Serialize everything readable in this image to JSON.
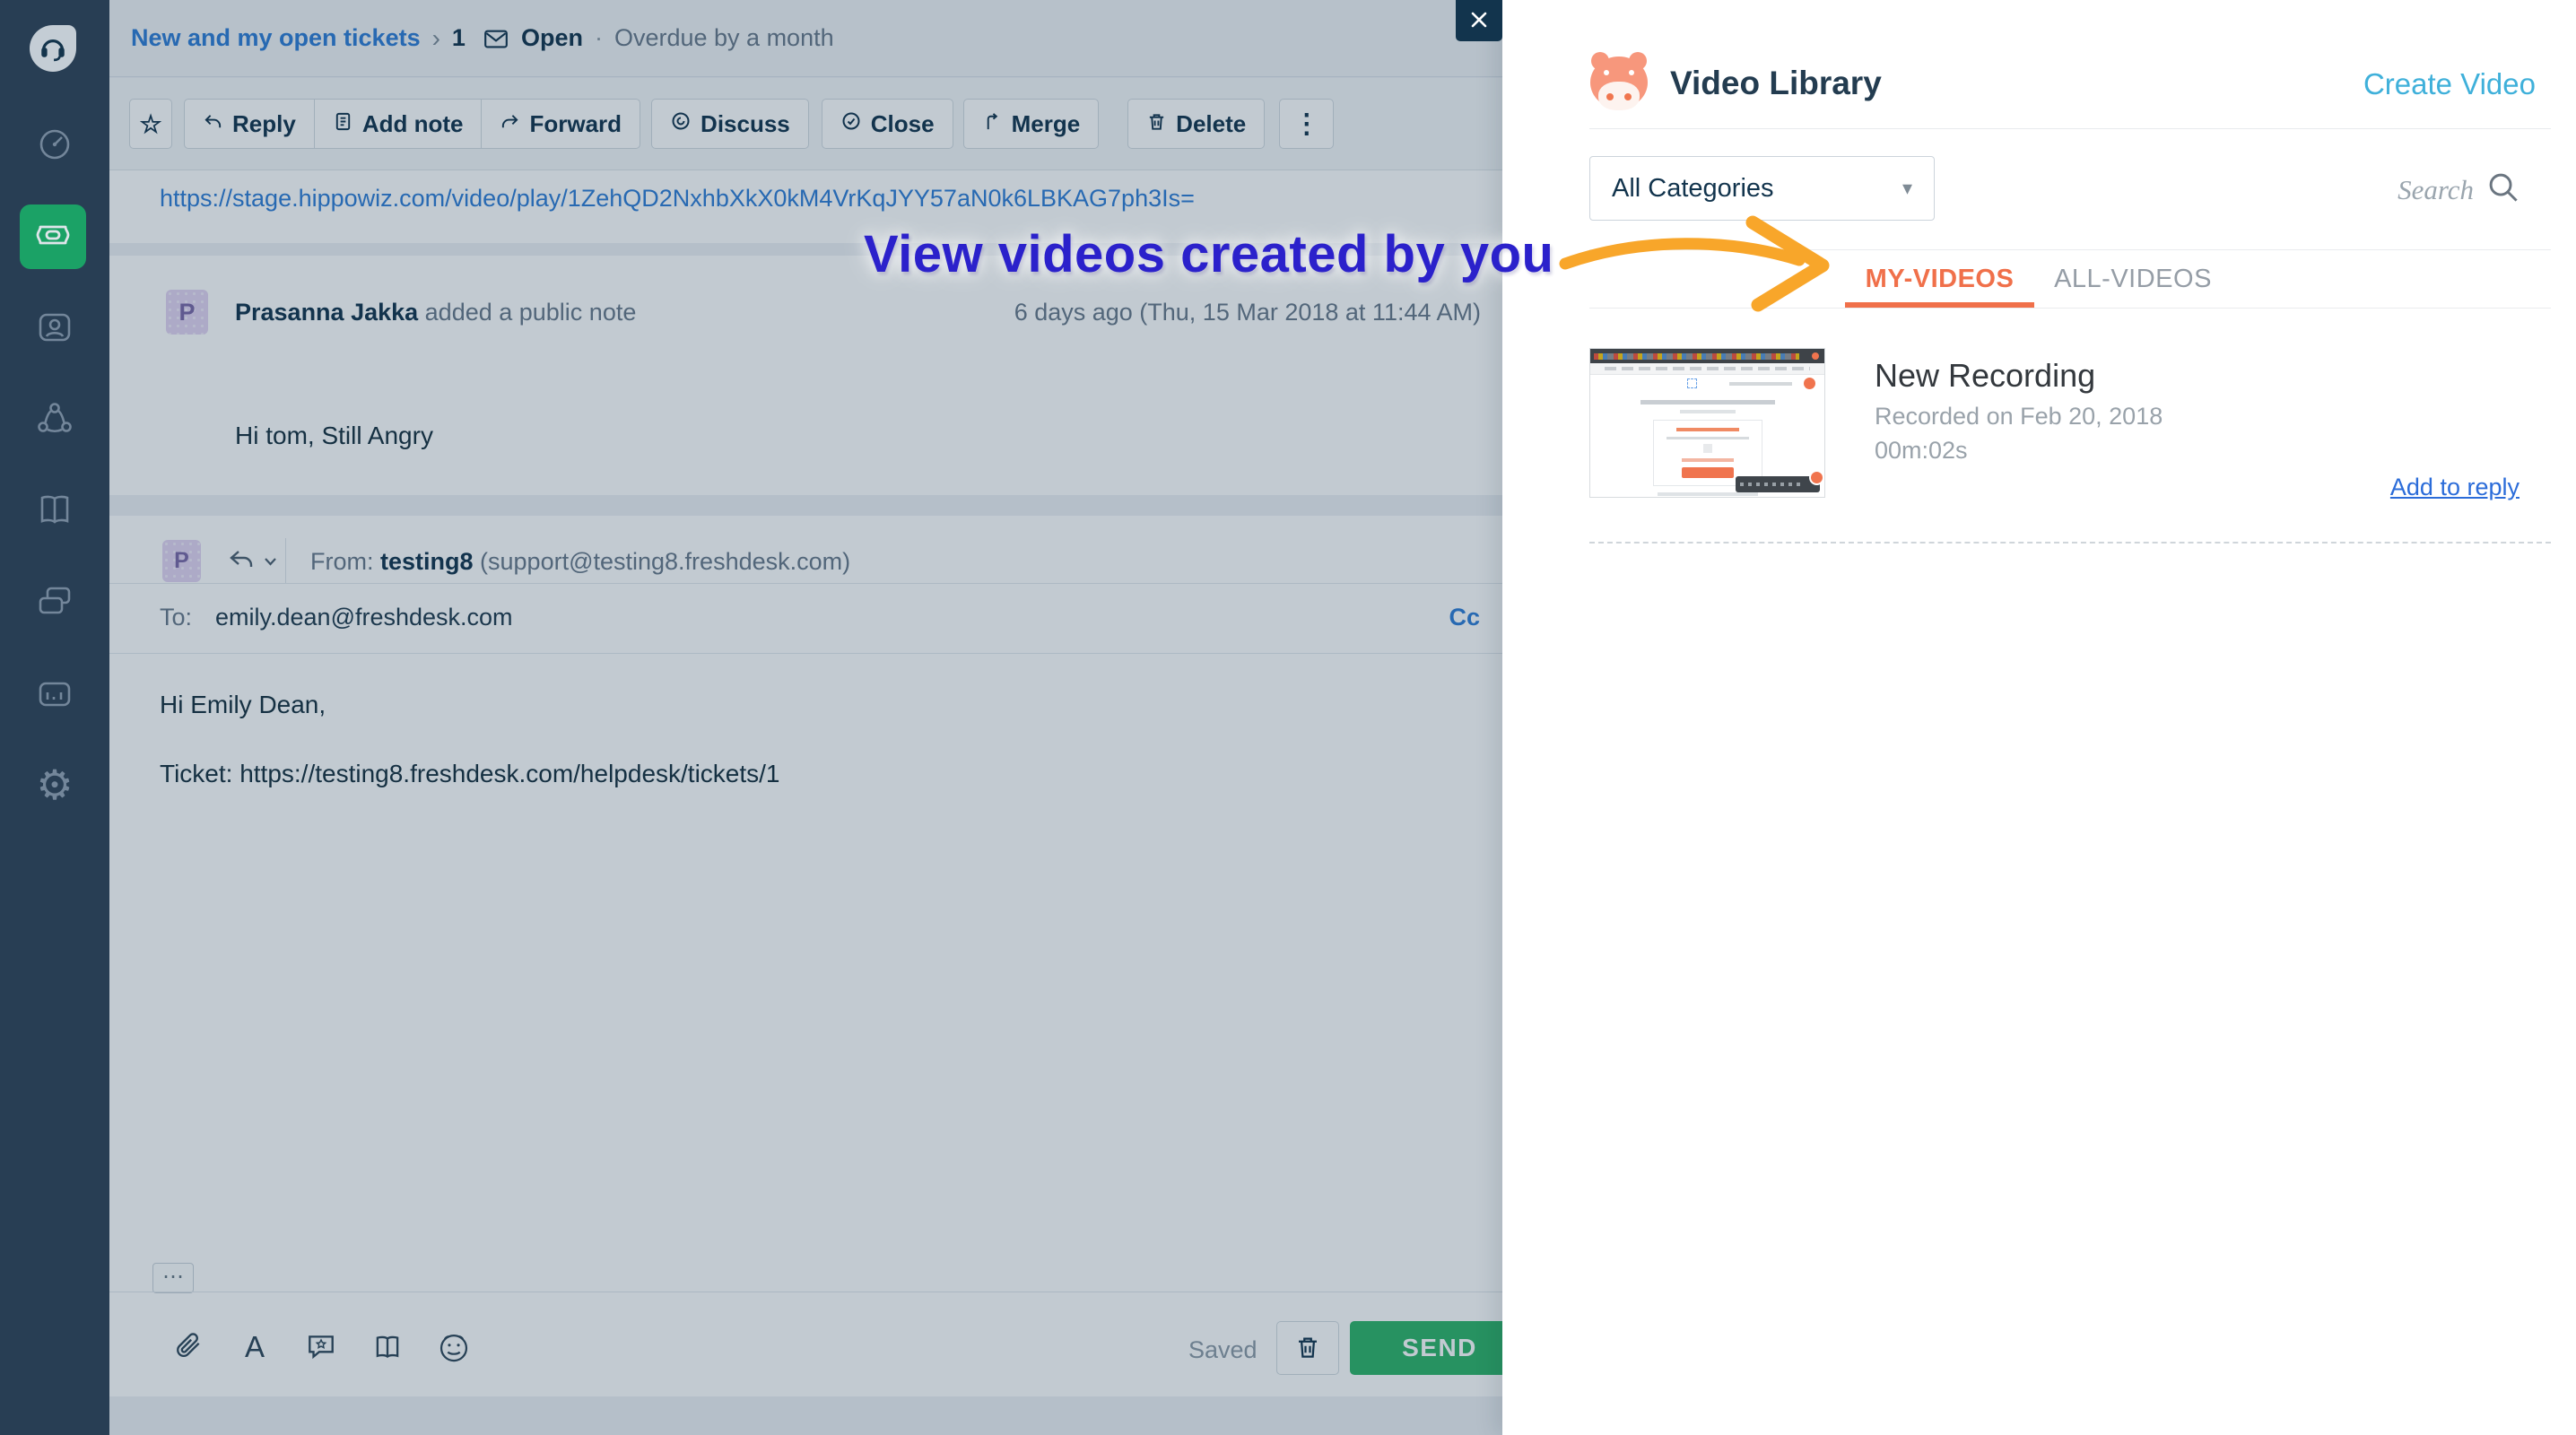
{
  "glyphs": {
    "star": "☆",
    "more": "⋮",
    "ellipsis": "⋯",
    "caret": "▾",
    "breadcrumb_sep": "›",
    "status_sep": "·",
    "gear": "⚙",
    "format_a": "A"
  },
  "sidebar": {
    "items": [
      {
        "name": "dashboard"
      },
      {
        "name": "tickets",
        "active": true
      },
      {
        "name": "contacts"
      },
      {
        "name": "social"
      },
      {
        "name": "solutions"
      },
      {
        "name": "forums"
      },
      {
        "name": "reports"
      },
      {
        "name": "settings"
      }
    ]
  },
  "header": {
    "breadcrumb": "New and my open tickets",
    "ticket_number": "1",
    "status": "Open",
    "overdue": "Overdue by a month"
  },
  "toolbar": {
    "reply": "Reply",
    "add_note": "Add note",
    "forward": "Forward",
    "discuss": "Discuss",
    "close": "Close",
    "merge": "Merge",
    "delete": "Delete"
  },
  "conversation": {
    "link": "https://stage.hippowiz.com/video/play/1ZehQD2NxhbXkX0kM4VrKqJYY57aN0k6LBKAG7ph3Is=",
    "note": {
      "avatar_initial": "P",
      "author": "Prasanna Jakka",
      "action": " added a public note",
      "timestamp": "6 days ago (Thu, 15 Mar 2018 at 11:44 AM)",
      "body": "Hi tom, Still Angry"
    },
    "reply": {
      "avatar_initial": "P",
      "from_label": "From: ",
      "from_name": "testing8",
      "from_email": " (support@testing8.freshdesk.com)",
      "to_label": "To:",
      "to_value": "emily.dean@freshdesk.com",
      "cc_label": "Cc",
      "body_line1": "Hi Emily Dean,",
      "body_line2": "Ticket: https://testing8.freshdesk.com/helpdesk/tickets/1"
    }
  },
  "composer": {
    "saved": "Saved",
    "send": "SEND"
  },
  "video_library": {
    "title": "Video Library",
    "create_video": "Create Video",
    "category_filter": "All Categories",
    "search_placeholder": "Search",
    "tabs": {
      "my_videos": "MY-VIDEOS",
      "all_videos": "ALL-VIDEOS"
    },
    "video": {
      "title": "New Recording",
      "recorded": "Recorded on Feb 20, 2018",
      "duration": "00m:02s",
      "add_to_reply": "Add to reply"
    }
  },
  "annotation": {
    "text": "View videos created by you"
  },
  "colors": {
    "accent_orange": "#f0704a",
    "brand_green": "#1ba266",
    "link_blue": "#2e7cd6",
    "create_video_blue": "#3fb0da",
    "annotation_blue": "#2b21cb",
    "arrow_orange": "#f8a62a",
    "sidebar_navy": "#283e54",
    "send_green": "#2eb469",
    "dark_navy": "#12344d"
  }
}
